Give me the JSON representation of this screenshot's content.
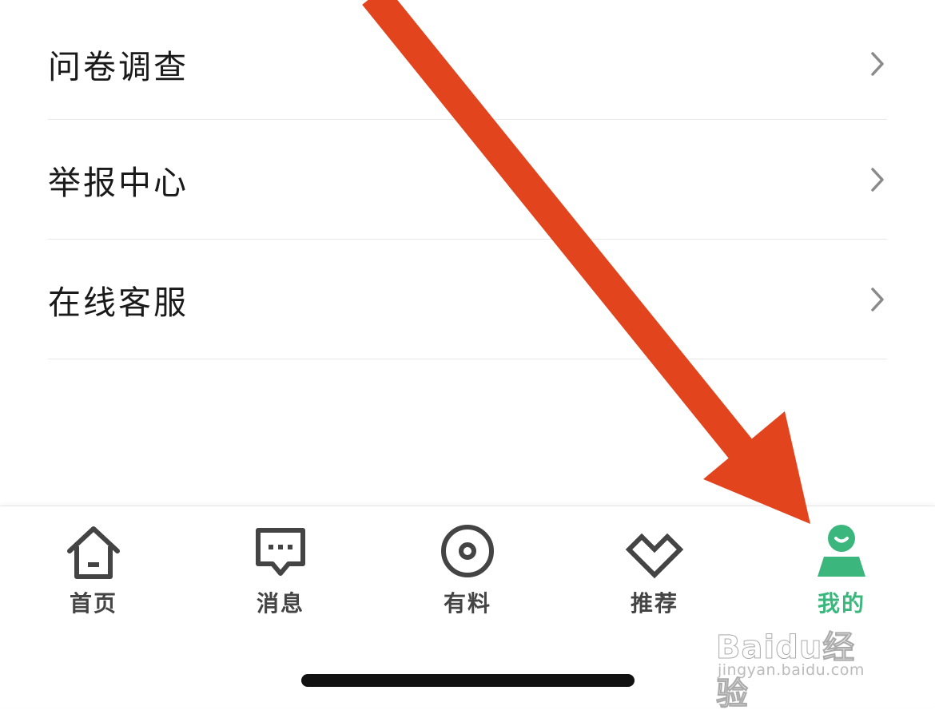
{
  "menu": {
    "items": [
      {
        "label": "问卷调查"
      },
      {
        "label": "举报中心"
      },
      {
        "label": "在线客服"
      }
    ]
  },
  "tabbar": {
    "tabs": [
      {
        "label": "首页",
        "icon": "home-icon"
      },
      {
        "label": "消息",
        "icon": "message-icon"
      },
      {
        "label": "有料",
        "icon": "disc-icon"
      },
      {
        "label": "推荐",
        "icon": "heart-icon"
      },
      {
        "label": "我的",
        "icon": "person-icon",
        "active": true
      }
    ],
    "active_color": "#3bb77e",
    "inactive_color": "#444444"
  },
  "annotation": {
    "arrow_color": "#e2441e"
  },
  "watermark": {
    "brand": "Baidu经验",
    "url": "jingyan.baidu.com"
  }
}
